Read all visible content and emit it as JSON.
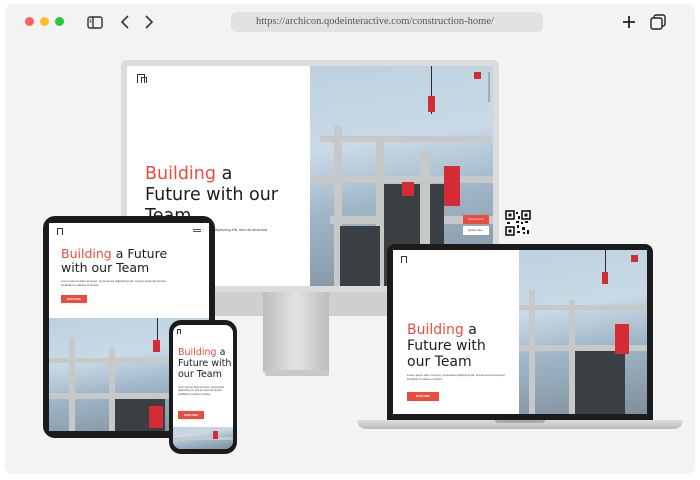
{
  "browser": {
    "url": "https://archicon.qodeinteractive.com/construction-home/"
  },
  "hero": {
    "headline_accent": "Building",
    "headline_rest_desktop": " a Future with our Team",
    "headline_line1_rest": " a",
    "headline_line2": "Future with our",
    "headline_line3": "Team",
    "tablet_line1_rest": " a Future",
    "tablet_line2": "with our Team",
    "phone_line1": "Building a",
    "phone_line2": "Future with",
    "phone_line3": "our Team",
    "laptop_line1_rest": " a",
    "laptop_line2": "Future with",
    "laptop_line3": "our Team",
    "body": "Lorem ipsum dolor sit amet, consectetur adipiscing elit, sed do eiusmod tempor incididunt ut labore et dolore",
    "body_tablet": "Lorem ipsum dolor sit amet, consectetur adipiscing elit, sed do eiusmod tempor incididunt ut labore et dolore",
    "desktop_body_fragment": "tur adipiscing elit, sed do eiusmod",
    "cta_label": "EXPLORE",
    "side_badge_top": "Tell a friend",
    "side_badge_bottom": "Quick links"
  },
  "icons": {
    "sidebar": "sidebar-toggle-icon",
    "back": "chevron-left-icon",
    "forward": "chevron-right-icon",
    "new_tab": "plus-icon",
    "tabs": "tabs-overview-icon"
  },
  "colors": {
    "accent": "#ec4c3f",
    "device_frame": "#1b1b1b",
    "stand": "#d8d8d8"
  }
}
